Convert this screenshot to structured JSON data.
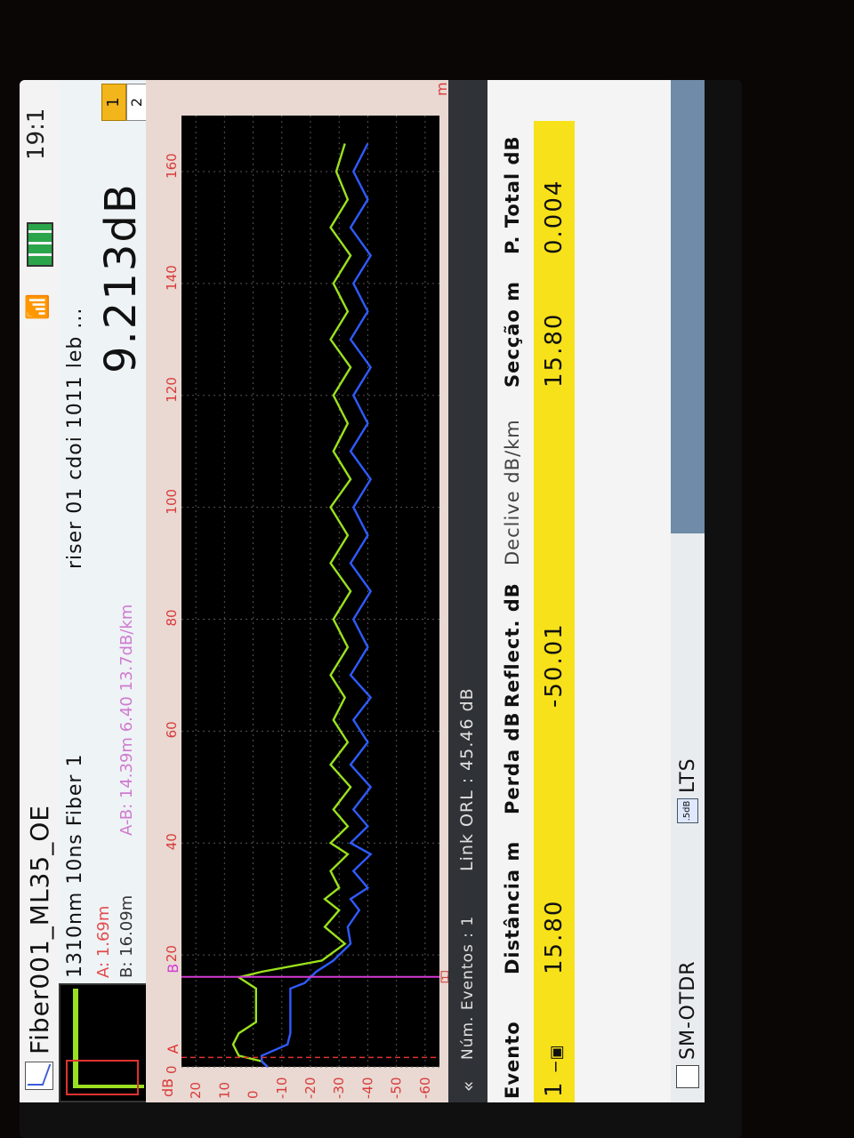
{
  "title_bar": {
    "file_name": "Fiber001_ML35_OE",
    "clock": "19:1"
  },
  "info": {
    "params": "1310nm 10ns Fiber 1",
    "fiber_desc": "riser 01 cdoi 1011 leb ...",
    "cursor_a": "A: 1.69m",
    "cursor_b": "B: 16.09m",
    "cursor_ab": "A-B: 14.39m 6.40 13.7dB/km",
    "total_loss": "9.213dB",
    "button_1": "1",
    "button_2": "2"
  },
  "graph": {
    "y_unit": "dB",
    "y_ticks": [
      "20",
      "10",
      "0",
      "-10",
      "-20",
      "-30",
      "-40",
      "-50",
      "-60"
    ],
    "x_ticks": [
      "0",
      "20",
      "40",
      "60",
      "80",
      "100",
      "120",
      "140",
      "160"
    ],
    "x_unit": "m",
    "marker_a": "A",
    "marker_b": "B",
    "event_marker": "1",
    "colors": {
      "trace_green": "#9be21c",
      "trace_blue": "#2f5bff",
      "marker_a": "#e03232",
      "marker_b": "#d43ad4"
    }
  },
  "events": {
    "count_label": "Núm. Eventos : 1",
    "orl_label": "Link ORL :  45.46 dB",
    "headers": [
      "Evento",
      "Distância m",
      "Perda dB",
      "Reflect. dB",
      "Declive dB/km",
      "Secção m",
      "P. Total dB"
    ],
    "rows": [
      {
        "num": "1",
        "distance": "15.80",
        "loss": "",
        "reflect": "-50.01",
        "slope": "",
        "section": "15.80",
        "total": "0.004"
      }
    ]
  },
  "footer": {
    "tab_otdr": "SM-OTDR",
    "tab_lts": "LTS",
    "lts_icon": ".5dB"
  },
  "chart_data": {
    "type": "line",
    "title": "",
    "xlabel": "m",
    "ylabel": "dB",
    "xlim": [
      0,
      170
    ],
    "ylim": [
      -65,
      25
    ],
    "series": [
      {
        "values": [
          [
            0,
            -5
          ],
          [
            1,
            -3
          ],
          [
            2,
            5
          ],
          [
            4,
            7
          ],
          [
            6,
            5
          ],
          [
            8,
            -1
          ],
          [
            10,
            -1
          ],
          [
            14,
            -1
          ],
          [
            16,
            5
          ],
          [
            17,
            -3
          ],
          [
            19,
            -24
          ],
          [
            22,
            -32
          ],
          [
            25,
            -25
          ],
          [
            28,
            -30
          ],
          [
            30,
            -25
          ],
          [
            32,
            -30
          ],
          [
            35,
            -27
          ],
          [
            38,
            -33
          ],
          [
            40,
            -27
          ],
          [
            43,
            -33
          ],
          [
            46,
            -28
          ],
          [
            50,
            -34
          ],
          [
            54,
            -27
          ],
          [
            58,
            -33
          ],
          [
            62,
            -28
          ],
          [
            66,
            -32
          ],
          [
            70,
            -27
          ],
          [
            75,
            -33
          ],
          [
            80,
            -28
          ],
          [
            85,
            -34
          ],
          [
            90,
            -27
          ],
          [
            95,
            -33
          ],
          [
            100,
            -27
          ],
          [
            105,
            -34
          ],
          [
            110,
            -28
          ],
          [
            115,
            -33
          ],
          [
            120,
            -28
          ],
          [
            125,
            -34
          ],
          [
            130,
            -27
          ],
          [
            135,
            -33
          ],
          [
            140,
            -28
          ],
          [
            145,
            -34
          ],
          [
            150,
            -27
          ],
          [
            155,
            -33
          ],
          [
            160,
            -29
          ],
          [
            165,
            -32
          ]
        ]
      },
      {
        "values": [
          [
            0,
            -5
          ],
          [
            1,
            -3
          ],
          [
            2,
            -3
          ],
          [
            4,
            -12
          ],
          [
            6,
            -13
          ],
          [
            10,
            -13
          ],
          [
            14,
            -13
          ],
          [
            15,
            -18
          ],
          [
            17,
            -22
          ],
          [
            19,
            -28
          ],
          [
            22,
            -34
          ],
          [
            25,
            -33
          ],
          [
            28,
            -37
          ],
          [
            30,
            -34
          ],
          [
            32,
            -40
          ],
          [
            35,
            -35
          ],
          [
            38,
            -41
          ],
          [
            40,
            -34
          ],
          [
            43,
            -40
          ],
          [
            46,
            -35
          ],
          [
            50,
            -41
          ],
          [
            54,
            -34
          ],
          [
            58,
            -40
          ],
          [
            62,
            -35
          ],
          [
            66,
            -41
          ],
          [
            70,
            -34
          ],
          [
            75,
            -40
          ],
          [
            80,
            -35
          ],
          [
            85,
            -41
          ],
          [
            90,
            -34
          ],
          [
            95,
            -40
          ],
          [
            100,
            -35
          ],
          [
            105,
            -41
          ],
          [
            110,
            -34
          ],
          [
            115,
            -40
          ],
          [
            120,
            -35
          ],
          [
            125,
            -41
          ],
          [
            130,
            -34
          ],
          [
            135,
            -40
          ],
          [
            140,
            -35
          ],
          [
            145,
            -41
          ],
          [
            150,
            -34
          ],
          [
            155,
            -40
          ],
          [
            160,
            -35
          ],
          [
            165,
            -40
          ]
        ]
      }
    ]
  }
}
